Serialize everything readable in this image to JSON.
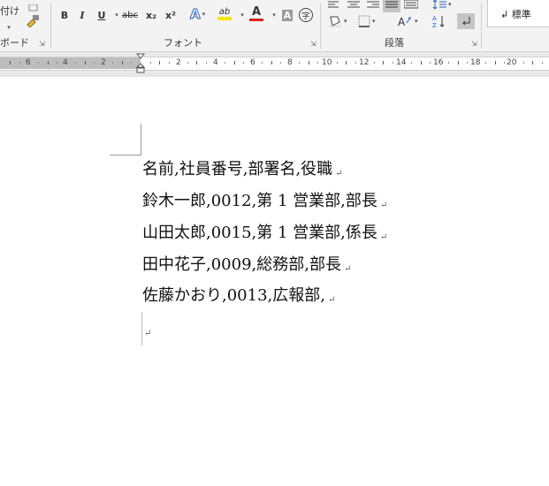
{
  "ribbon": {
    "clipboard": {
      "label": "ボード",
      "paste_label": "付け"
    },
    "font": {
      "label": "フォント",
      "bold": "B",
      "italic": "I",
      "underline": "U",
      "strikethrough": "abc",
      "subscript": "x₂",
      "superscript": "x²",
      "text_effects": "A",
      "highlight": "ab",
      "font_color": "A",
      "char_shading": "A",
      "enclose_char": "字"
    },
    "paragraph": {
      "label": "段落"
    },
    "styles": {
      "current": "↲ 標準"
    },
    "colors": {
      "highlight": "#f5e400",
      "font_color": "#d7261e",
      "accent_blue": "#2b5fb4"
    }
  },
  "ruler": {
    "left_numbers": [
      "6",
      "4",
      "2"
    ],
    "right_numbers": [
      "2",
      "4",
      "6",
      "8",
      "10",
      "12",
      "14",
      "16",
      "18",
      "20"
    ]
  },
  "document": {
    "lines": [
      "名前,社員番号,部署名,役職",
      "鈴木一郎,0012,第 1 営業部,部長",
      "山田太郎,0015,第 1 営業部,係長",
      "田中花子,0009,総務部,部長",
      "佐藤かおり,0013,広報部,"
    ],
    "paragraph_mark": "↵"
  }
}
